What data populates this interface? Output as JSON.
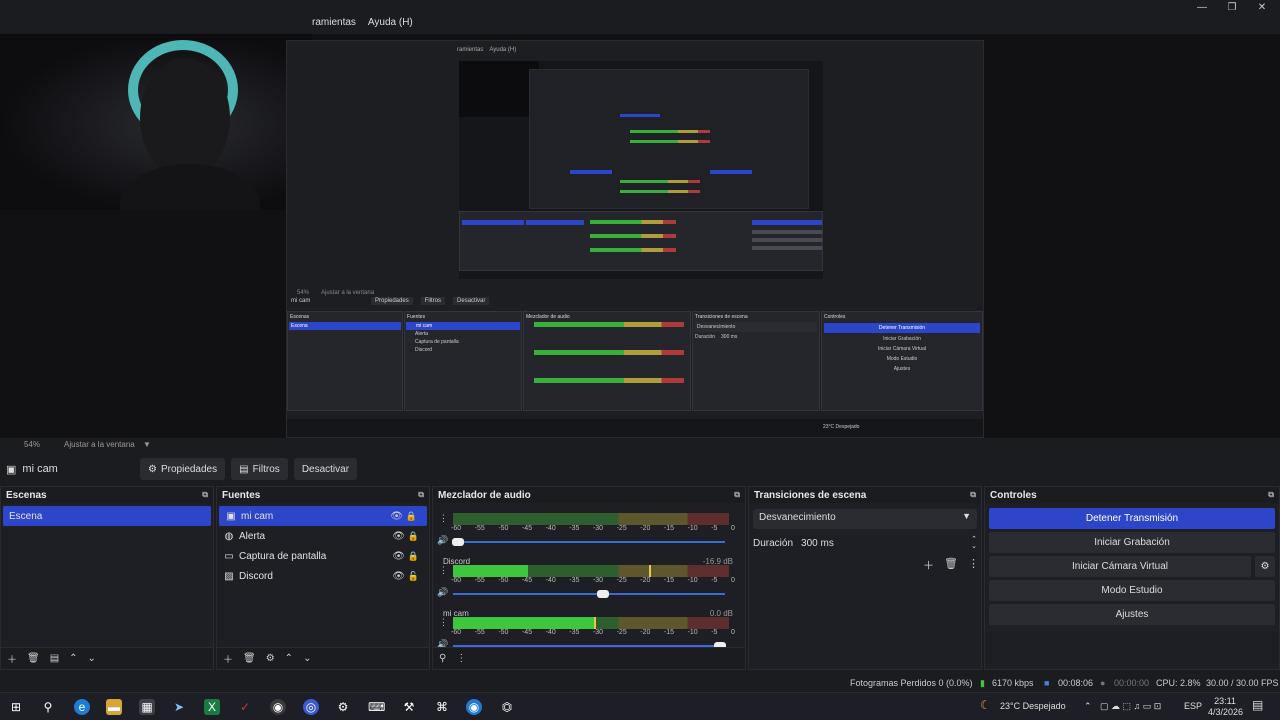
{
  "menu": {
    "items": [
      "ramientas",
      "Ayuda (H)"
    ]
  },
  "window_controls": [
    "—",
    "❐",
    "✕"
  ],
  "nested_preview": {
    "menu_items": [
      "ramientas",
      "Ayuda (H)"
    ],
    "context": {
      "source": "mi cam",
      "props": "Propiedades",
      "filters": "Filtros",
      "disable": "Desactivar"
    },
    "headers": [
      "Escenas",
      "Fuentes",
      "Mezclador de audio",
      "Transiciones de escena",
      "Controles"
    ],
    "scene": "Escena",
    "sources": [
      "mi cam",
      "Alerta",
      "Captura de pantalla",
      "Discord"
    ],
    "controls": [
      "Detener Transmisión",
      "Iniciar Grabación",
      "Iniciar Cámara Virtual",
      "Modo Estudio",
      "Ajustes"
    ],
    "transition": "Desvanecimiento",
    "duration_label": "Duración",
    "duration_value": "300 ms",
    "weather": "23°C Despejado",
    "zoom": "54%",
    "fit": "Ajustar a la ventana"
  },
  "zoom": {
    "level": "54%",
    "fit_label": "Ajustar a la ventana"
  },
  "context_bar": {
    "source_name": "mi cam",
    "properties": "Propiedades",
    "filters": "Filtros",
    "disable": "Desactivar"
  },
  "scenes": {
    "title": "Escenas",
    "items": [
      "Escena"
    ]
  },
  "sources": {
    "title": "Fuentes",
    "items": [
      {
        "name": "mi cam",
        "icon": "camera-icon",
        "locked": true
      },
      {
        "name": "Alerta",
        "icon": "globe-icon",
        "locked": true
      },
      {
        "name": "Captura de pantalla",
        "icon": "monitor-icon",
        "locked": true
      },
      {
        "name": "Discord",
        "icon": "image-icon",
        "locked": false
      }
    ]
  },
  "mixer": {
    "title": "Mezclador de audio",
    "ticks": [
      "-60",
      "-55",
      "-50",
      "-45",
      "-40",
      "-35",
      "-30",
      "-25",
      "-20",
      "-15",
      "-10",
      "-5",
      "0"
    ],
    "channels": [
      {
        "name": "",
        "db": "",
        "level": 0.0,
        "peak": 0.0,
        "volume": 0.02
      },
      {
        "name": "Discord",
        "db": "-16.9 dB",
        "level": 0.27,
        "peak": 0.71,
        "volume": 0.55
      },
      {
        "name": "mi cam",
        "db": "0.0 dB",
        "level": 0.51,
        "peak": 0.51,
        "volume": 0.98
      }
    ]
  },
  "transitions": {
    "title": "Transiciones de escena",
    "selected": "Desvanecimiento",
    "duration_label": "Duración",
    "duration_value": "300 ms"
  },
  "controls": {
    "title": "Controles",
    "stop_stream": "Detener Transmisión",
    "start_recording": "Iniciar Grabación",
    "start_virtual_cam": "Iniciar Cámara Virtual",
    "studio_mode": "Modo Estudio",
    "settings": "Ajustes"
  },
  "status": {
    "dropped_frames": "Fotogramas Perdidos 0 (0.0%)",
    "bitrate": "6170 kbps",
    "stream_time": "00:08:06",
    "rec_time": "00:00:00",
    "cpu": "CPU: 2.8%",
    "fps": "30.00 / 30.00 FPS"
  },
  "taskbar": {
    "weather": "23°C Despejado",
    "language": "ESP",
    "time": "23:11",
    "date": "4/3/2026"
  },
  "colors": {
    "accent": "#2d46c9",
    "background": "#1e1f24",
    "meter_green": "#3ec73e"
  }
}
